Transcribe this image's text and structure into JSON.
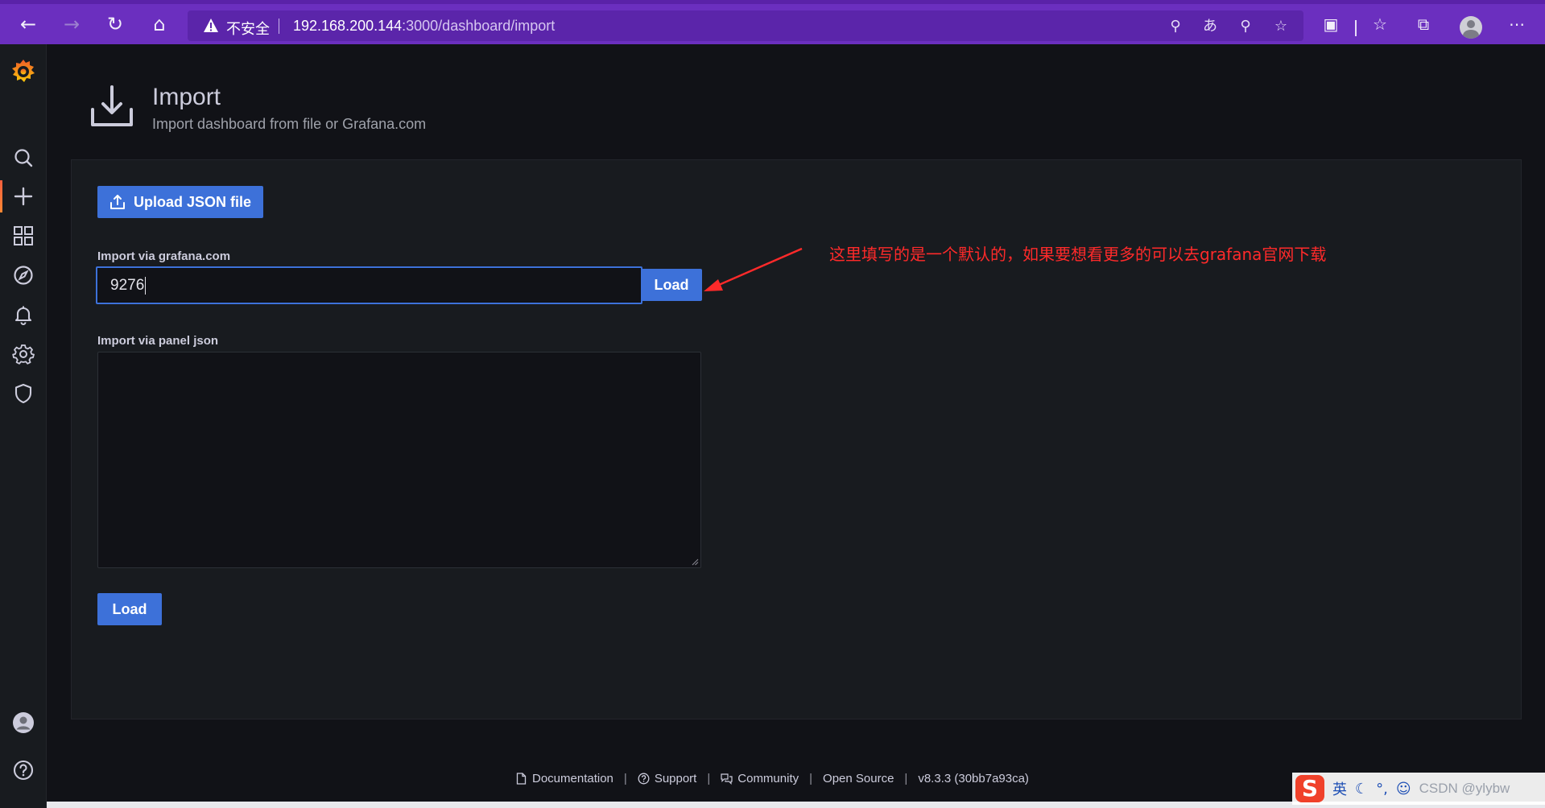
{
  "browser": {
    "insecure_label": "不安全",
    "url_host": "192.168.200.144",
    "url_rest": ":3000/dashboard/import"
  },
  "sidebar": {
    "items": [
      {
        "name": "search",
        "icon": "search-icon"
      },
      {
        "name": "create",
        "icon": "plus-icon",
        "active": true
      },
      {
        "name": "dashboards",
        "icon": "apps-icon"
      },
      {
        "name": "explore",
        "icon": "compass-icon"
      },
      {
        "name": "alerting",
        "icon": "bell-icon"
      },
      {
        "name": "configuration",
        "icon": "cog-icon"
      },
      {
        "name": "server-admin",
        "icon": "shield-icon"
      }
    ],
    "bottom": [
      {
        "name": "profile",
        "icon": "user-avatar-icon"
      },
      {
        "name": "help",
        "icon": "question-circle-icon"
      }
    ]
  },
  "header": {
    "title": "Import",
    "subtitle": "Import dashboard from file or Grafana.com"
  },
  "import": {
    "upload_label": "Upload JSON file",
    "grafana_label": "Import via grafana.com",
    "grafana_value": "9276",
    "load_label": "Load",
    "panel_json_label": "Import via panel json",
    "panel_json_value": "",
    "load_bottom_label": "Load"
  },
  "annotation": {
    "text": "这里填写的是一个默认的，如果要想看更多的可以去grafana官网下载",
    "color": "#ff2a2a"
  },
  "footer": {
    "documentation": "Documentation",
    "support": "Support",
    "community": "Community",
    "open_source": "Open Source",
    "version": "v8.3.3 (30bb7a93ca)"
  },
  "ime": {
    "lang": "英",
    "watermark": "CSDN @ylybw"
  },
  "colors": {
    "accent": "#3d71d9",
    "browser": "#6b2fbf",
    "background": "#111217",
    "panel": "#181b1f"
  }
}
